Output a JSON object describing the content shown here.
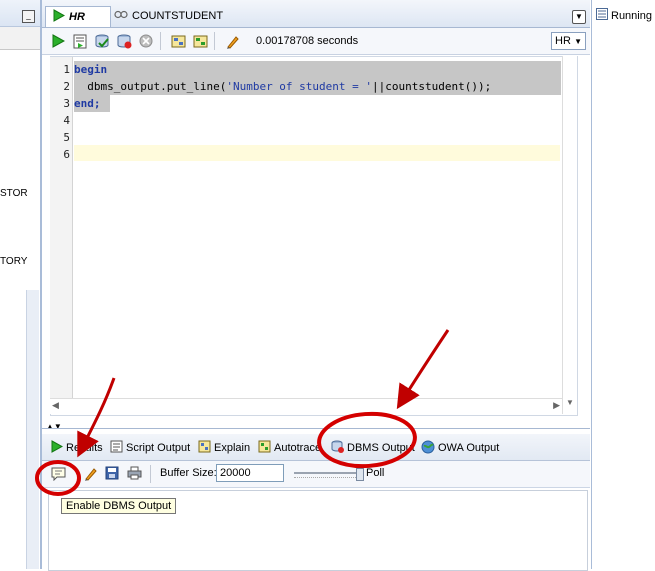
{
  "left_panel": {
    "minimize_glyph": "_",
    "items": [
      "STOR",
      "TORY"
    ]
  },
  "editor": {
    "tabs": [
      {
        "label": "HR",
        "active": true,
        "icon": "play-icon"
      },
      {
        "label": "COUNTSTUDENT",
        "active": false,
        "icon": "procedure-icon"
      }
    ],
    "toolbar": {
      "icons": [
        "run-statement-icon",
        "run-script-icon",
        "commit-icon",
        "rollback-icon",
        "cancel-icon",
        "explain-plan-icon",
        "autotrace-icon",
        "clear-icon"
      ],
      "elapsed_time": "0.00178708 seconds",
      "connection": "HR"
    },
    "lines": [
      {
        "no": "1",
        "text": "begin"
      },
      {
        "no": "2",
        "text": "  dbms_output.put_line('Number of student = '||countstudent());"
      },
      {
        "no": "3",
        "text": "end;"
      },
      {
        "no": "4",
        "text": ""
      },
      {
        "no": "5",
        "text": ""
      },
      {
        "no": "6",
        "text": ""
      }
    ],
    "code_parts": {
      "begin": "begin",
      "call_prefix": "  dbms_output.put_line(",
      "string_literal": "'Number of student = '",
      "call_suffix": "||countstudent());",
      "end": "end;"
    }
  },
  "output": {
    "tabs": [
      {
        "label": "Results",
        "icon": "results-icon"
      },
      {
        "label": "Script Output",
        "icon": "script-output-icon"
      },
      {
        "label": "Explain",
        "icon": "explain-icon"
      },
      {
        "label": "Autotrace",
        "icon": "autotrace-icon"
      },
      {
        "label": "DBMS Output",
        "icon": "dbms-output-icon"
      },
      {
        "label": "OWA Output",
        "icon": "owa-output-icon"
      }
    ],
    "buffer_label": "Buffer Size:",
    "buffer_value": "20000",
    "poll_label": "Poll",
    "tooltip": "Enable DBMS Output"
  },
  "right_panel": {
    "tab_label": "Running"
  },
  "colors": {
    "annotation": "#d40000",
    "keyword": "#1f3aa3",
    "selection": "#c6c6c6",
    "current_line": "#fffbdc"
  }
}
